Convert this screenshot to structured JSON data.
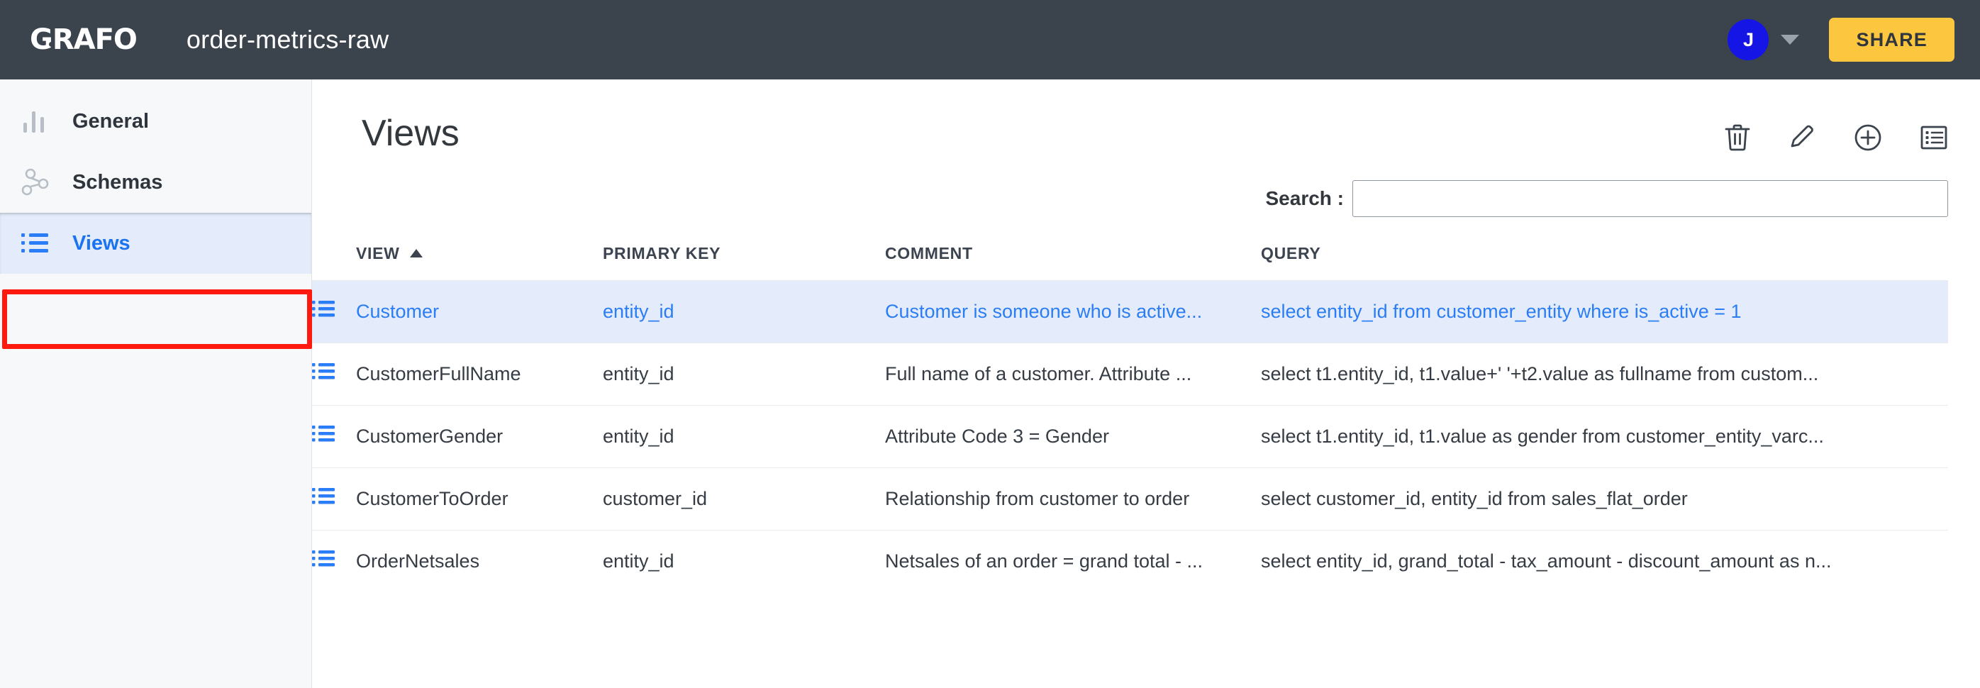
{
  "topbar": {
    "logo_text": "GRAFO",
    "project_title": "order-metrics-raw",
    "avatar_initial": "J",
    "share_label": "SHARE"
  },
  "sidebar": {
    "items": [
      {
        "label": "General",
        "icon": "bar-chart-icon",
        "active": false
      },
      {
        "label": "Schemas",
        "icon": "graph-nodes-icon",
        "active": false
      },
      {
        "label": "Views",
        "icon": "list-icon",
        "active": true
      }
    ]
  },
  "main": {
    "page_title": "Views",
    "toolbar": [
      {
        "name": "delete-button",
        "icon": "trash-icon"
      },
      {
        "name": "edit-button",
        "icon": "pencil-icon"
      },
      {
        "name": "add-button",
        "icon": "plus-circle-icon"
      },
      {
        "name": "list-view-button",
        "icon": "list-square-icon"
      }
    ],
    "search": {
      "label": "Search :",
      "value": "",
      "placeholder": ""
    },
    "table": {
      "columns": [
        {
          "label": "VIEW",
          "sorted": "asc"
        },
        {
          "label": "PRIMARY KEY",
          "sorted": ""
        },
        {
          "label": "COMMENT",
          "sorted": ""
        },
        {
          "label": "QUERY",
          "sorted": ""
        }
      ],
      "rows": [
        {
          "view": "Customer",
          "primary_key": "entity_id",
          "comment": "Customer is someone who is active...",
          "query": "select entity_id from customer_entity where is_active = 1",
          "selected": true
        },
        {
          "view": "CustomerFullName",
          "primary_key": "entity_id",
          "comment": "Full name of a customer. Attribute ...",
          "query": "select t1.entity_id, t1.value+' '+t2.value as fullname from custom...",
          "selected": false
        },
        {
          "view": "CustomerGender",
          "primary_key": "entity_id",
          "comment": "Attribute Code 3 = Gender",
          "query": "select t1.entity_id, t1.value as gender from customer_entity_varc...",
          "selected": false
        },
        {
          "view": "CustomerToOrder",
          "primary_key": "customer_id",
          "comment": "Relationship from customer to order",
          "query": "select customer_id, entity_id from sales_flat_order",
          "selected": false
        },
        {
          "view": "OrderNetsales",
          "primary_key": "entity_id",
          "comment": "Netsales of an order = grand total - ...",
          "query": "select entity_id, grand_total - tax_amount - discount_amount as n...",
          "selected": false
        }
      ]
    }
  },
  "annotation": {
    "highlight_target": "sidebar-item-views",
    "color": "#ff1a0f"
  },
  "colors": {
    "topbar_bg": "#3b434d",
    "accent_blue": "#2b7df5",
    "share_yellow": "#fdc63f",
    "avatar_blue": "#1515e6",
    "selected_row_bg": "#e4ecfb",
    "sidebar_bg": "#f6f8fa"
  }
}
